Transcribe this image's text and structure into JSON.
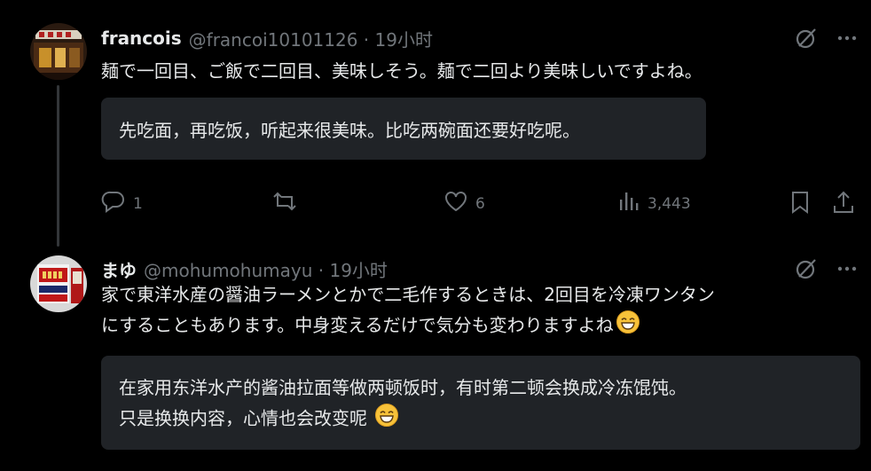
{
  "posts": [
    {
      "author_name": "francois",
      "handle": "@francoi10101126",
      "time": "19小时",
      "text": "麺で一回目、ご飯で二回目、美味しそう。麺で二回より美味しいですよね。",
      "translation": "先吃面，再吃饭，听起来很美味。比吃两碗面还要好吃呢。",
      "stats": {
        "replies": "1",
        "reposts": "",
        "likes": "6",
        "views": "3,443"
      }
    },
    {
      "author_name": "まゆ",
      "handle": "@mohumohumayu",
      "time": "19小时",
      "text_line1": "家で東洋水産の醤油ラーメンとかで二毛作するときは、2回目を冷凍ワンタン",
      "text_line2": "にすることもあります。中身変えるだけで気分も変わりますよね",
      "translation_line1": "在家用东洋水产的酱油拉面等做两顿饭时，有时第二顿会换成冷冻馄饨。",
      "translation_line2": "只是换换内容，心情也会改变呢"
    }
  ],
  "separator": " · ",
  "colors": {
    "background": "#000000",
    "text": "#e7e9ea",
    "secondary": "#71767b",
    "translation_bg": "#202327",
    "thread_line": "#333639"
  },
  "icons": [
    "grok-icon",
    "more-icon",
    "reply-icon",
    "repost-icon",
    "like-icon",
    "views-icon",
    "bookmark-icon",
    "share-icon",
    "grin-emoji-icon"
  ]
}
